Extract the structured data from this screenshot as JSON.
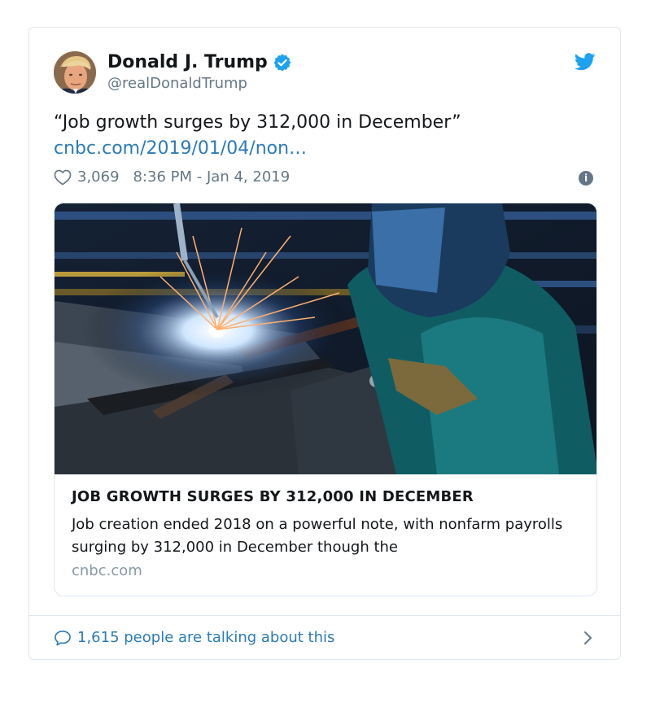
{
  "tweet": {
    "author_name": "Donald J. Trump",
    "handle": "@realDonaldTrump",
    "text": "“Job growth surges by 312,000 in December”",
    "link_text": "cnbc.com/2019/01/04/non…",
    "likes": "3,069",
    "timestamp": "8:36 PM - Jan 4, 2019"
  },
  "preview": {
    "title": "JOB GROWTH SURGES BY 312,000 IN DECEMBER",
    "description": "Job creation ended 2018 on a powerful note, with nonfarm payrolls surging by 312,000 in December though the",
    "domain": "cnbc.com"
  },
  "footer": {
    "talking_text": "1,615 people are talking about this"
  },
  "icons": {
    "verified": "verified-badge-icon",
    "brand": "twitter-bird-icon",
    "like": "heart-icon",
    "info": "info-icon",
    "reply": "speech-bubble-icon",
    "next": "chevron-right-icon"
  },
  "colors": {
    "link": "#2b7bb9",
    "twitter_blue": "#1da1f2",
    "muted": "#657786",
    "border": "#e1e8ed"
  }
}
